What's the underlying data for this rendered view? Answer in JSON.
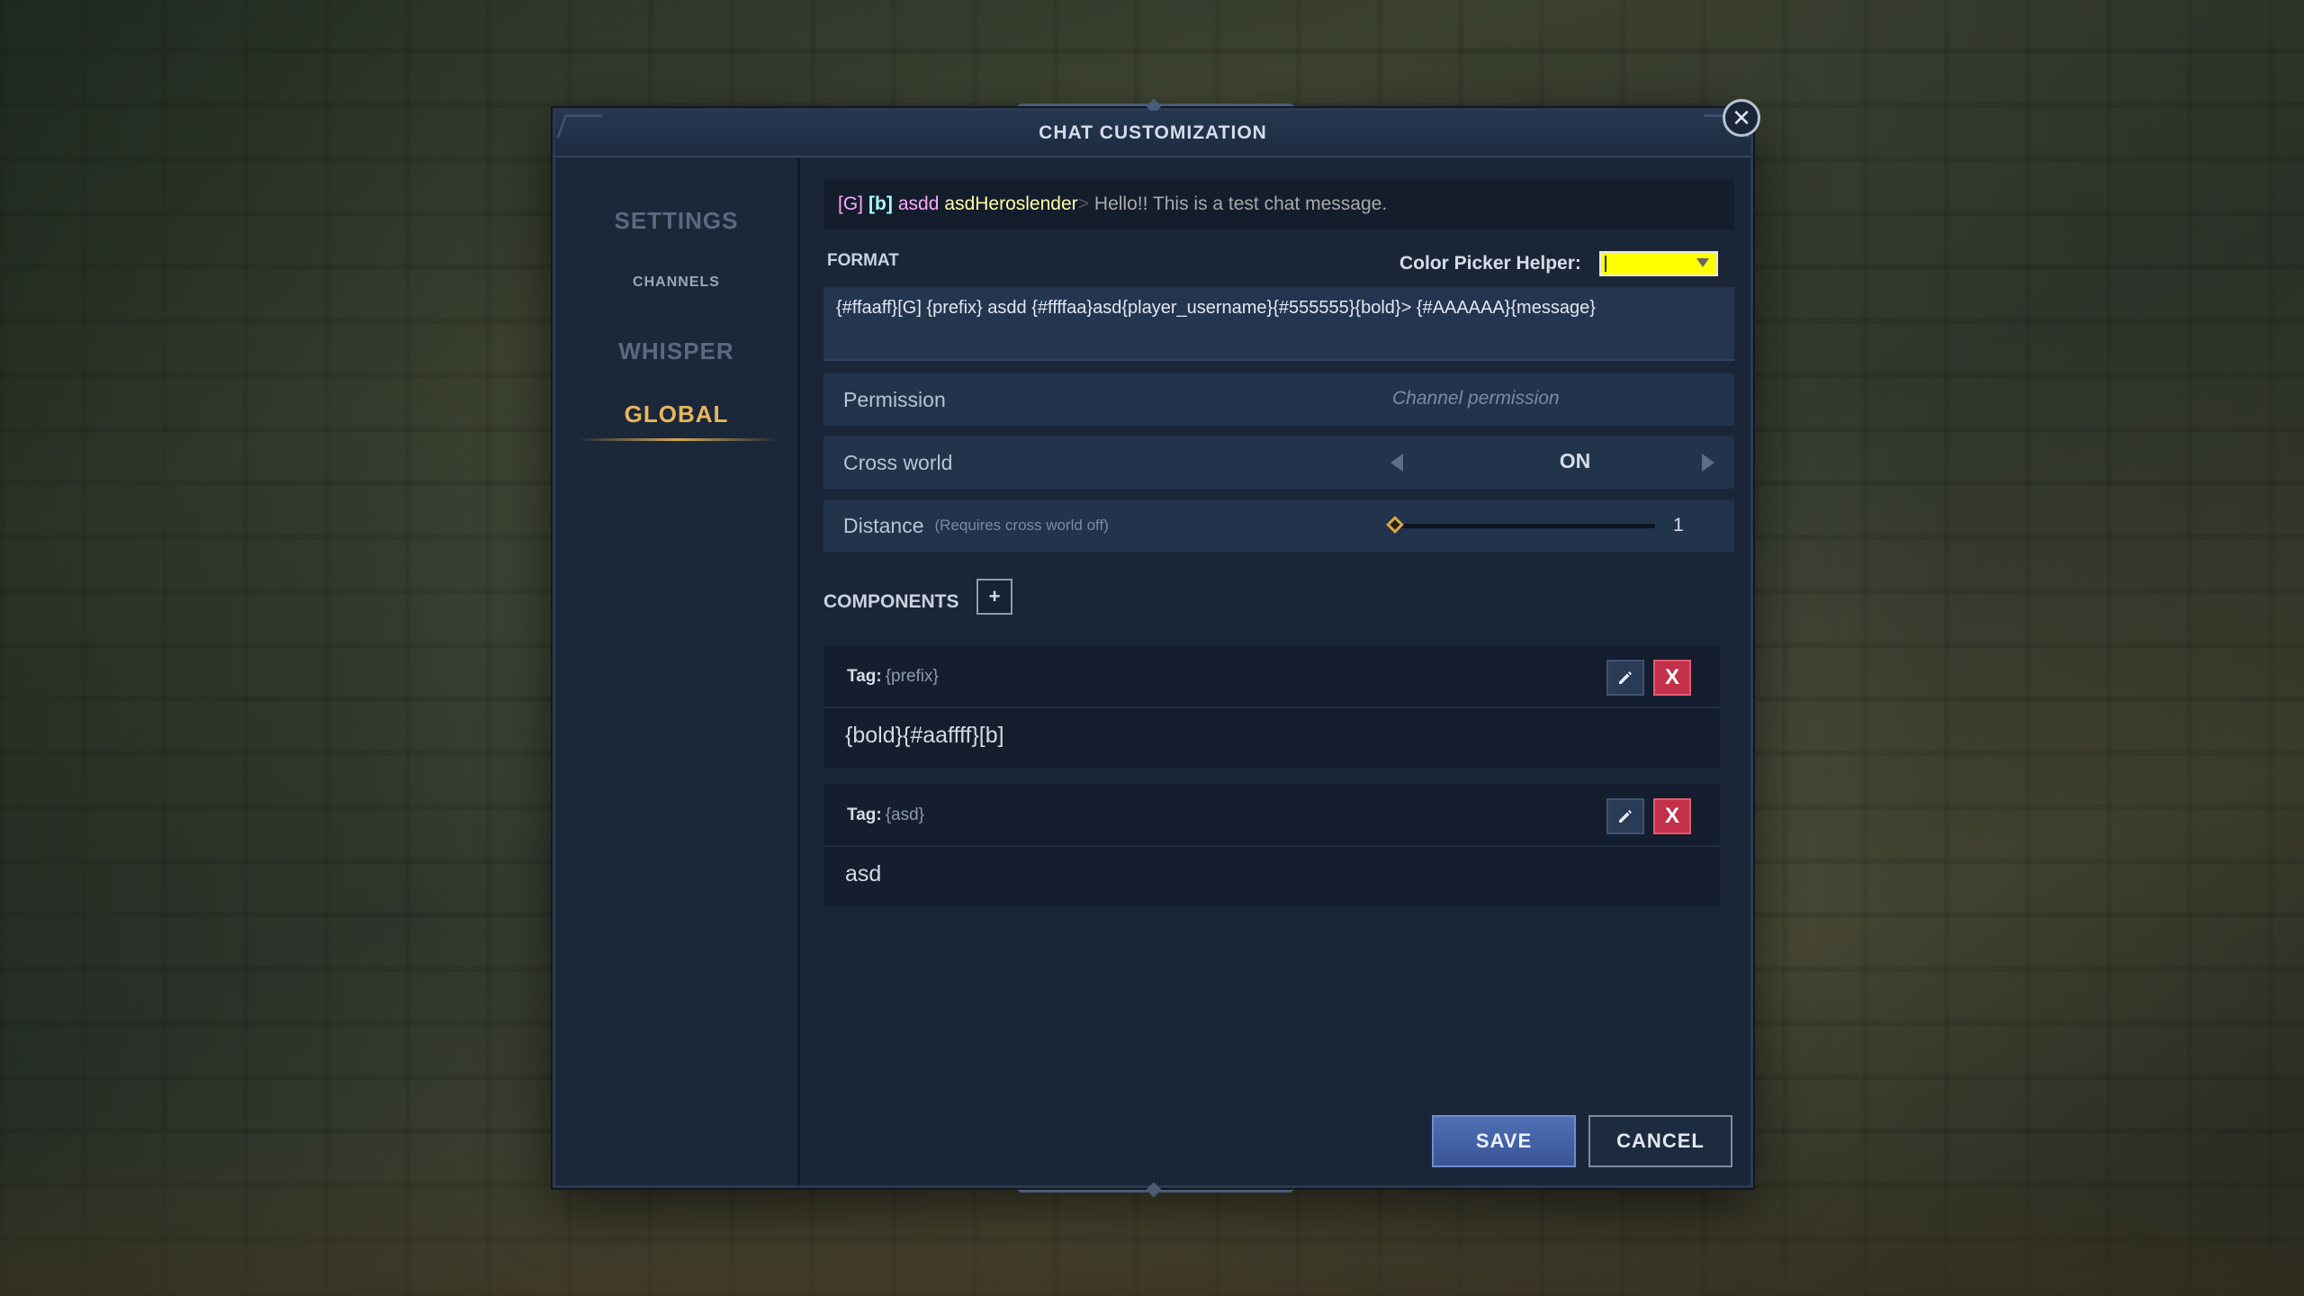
{
  "dialog": {
    "title": "CHAT CUSTOMIZATION",
    "close_symbol": "✕"
  },
  "sidebar": {
    "items": [
      {
        "label": "SETTINGS"
      },
      {
        "label": "CHANNELS"
      },
      {
        "label": "WHISPER"
      },
      {
        "label": "GLOBAL",
        "active": true
      }
    ]
  },
  "preview": {
    "segments": [
      {
        "text": "[G]",
        "color": "#ffaaff"
      },
      {
        "text": "[b]",
        "color": "#aaffff"
      },
      {
        "text": "asdd",
        "color": "#ffaaff"
      },
      {
        "text": "asdHeroslender",
        "color": "#ffffaa"
      },
      {
        "text": ">",
        "color": "#555555"
      },
      {
        "text": "Hello!! This is a test chat message.",
        "color": "#aaaaaa"
      }
    ]
  },
  "format": {
    "label": "FORMAT",
    "value": "{#ffaaff}[G] {prefix} asdd {#ffffaa}asd{player_username}{#555555}{bold}> {#AAAAAA}{message}"
  },
  "color_picker": {
    "label": "Color Picker Helper:",
    "value_color": "#ffff00"
  },
  "permission": {
    "label": "Permission",
    "placeholder": "Channel permission"
  },
  "cross_world": {
    "label": "Cross world",
    "value": "ON"
  },
  "distance": {
    "label": "Distance",
    "hint": "(Requires cross world off)",
    "value": "1"
  },
  "components": {
    "label": "COMPONENTS",
    "add_symbol": "+",
    "items": [
      {
        "tag_label": "Tag:",
        "tag_name": "{prefix}",
        "value": "{bold}{#aaffff}[b]",
        "delete_symbol": "X"
      },
      {
        "tag_label": "Tag:",
        "tag_name": "{asd}",
        "value": "asd",
        "delete_symbol": "X"
      }
    ]
  },
  "actions": {
    "save_label": "SAVE",
    "cancel_label": "CANCEL"
  },
  "colors": {
    "accent_gold": "#e7b75c",
    "save_blue": "#4e6fb6",
    "delete_red": "#c23049"
  }
}
